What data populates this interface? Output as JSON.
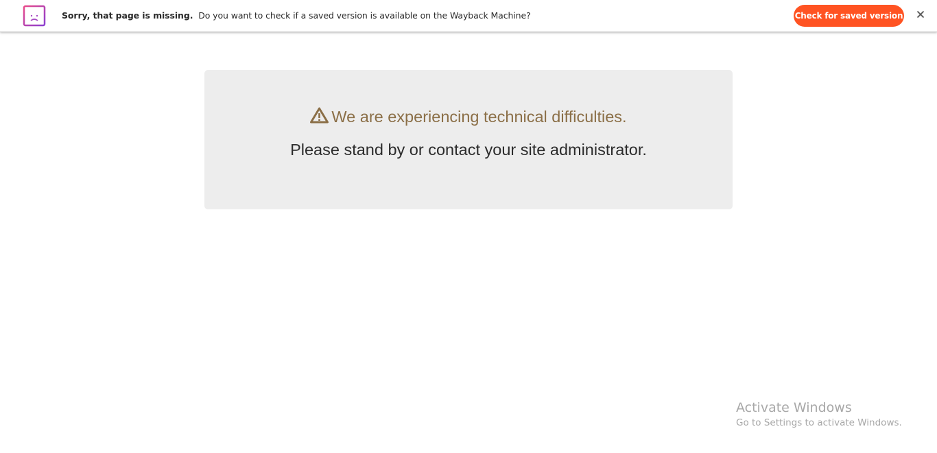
{
  "notice_bar": {
    "icon": "sad-browser-window-icon",
    "strong_text": "Sorry, that page is missing.",
    "message": "Do you want to check if a saved version is available on the Wayback Machine?",
    "button_label": "Check for saved version",
    "close_label": "✕",
    "close_icon": "close-icon",
    "button_color": "#ff5322",
    "icon_colors": [
      "#e94b8a",
      "#8b3fd1"
    ]
  },
  "error": {
    "icon": "warning-triangle-icon",
    "title": "We are experiencing technical difficulties.",
    "subtitle": "Please stand by or contact your site administrator.",
    "title_color": "#8b6f47",
    "box_color": "#ededed"
  },
  "watermark": {
    "title": "Activate Windows",
    "subtitle": "Go to Settings to activate Windows."
  }
}
